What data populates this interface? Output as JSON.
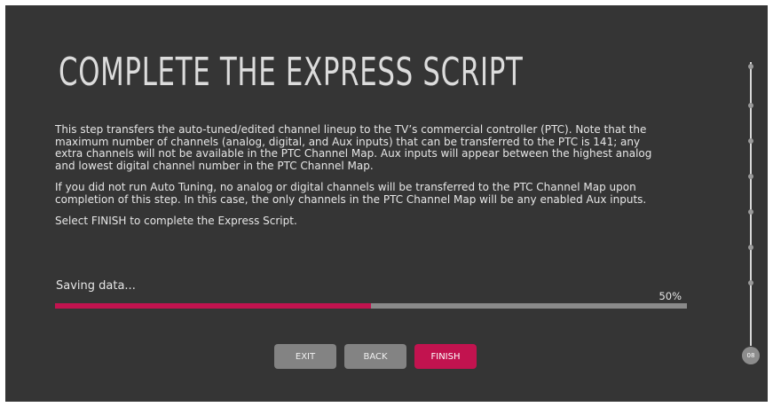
{
  "page": {
    "title": "COMPLETE THE EXPRESS SCRIPT",
    "paragraphs": [
      "This step transfers the auto-tuned/edited channel lineup to the TV’s commercial controller (PTC). Note that the maximum number of channels (analog, digital, and Aux inputs) that can be transferred to the PTC is 141; any extra channels will not be available in the PTC Channel Map. Aux inputs will appear between the highest analog and lowest digital channel number in the PTC Channel Map.",
      "If you did not run Auto Tuning, no analog or digital channels will be transferred to the PTC Channel Map upon completion of this step. In this case, the only channels in the PTC Channel Map will be any enabled Aux inputs.",
      "Select FINISH to complete the Express Script."
    ]
  },
  "progress": {
    "status": "Saving data...",
    "percent_label": "50%",
    "value": 0.5
  },
  "buttons": {
    "exit": "EXIT",
    "back": "BACK",
    "finish": "FINISH"
  },
  "stepper": {
    "current_step": "08",
    "total_steps": 8
  },
  "colors": {
    "background": "#353535",
    "accent": "#c2134f",
    "button": "#838383",
    "track": "#8a8a8a"
  }
}
